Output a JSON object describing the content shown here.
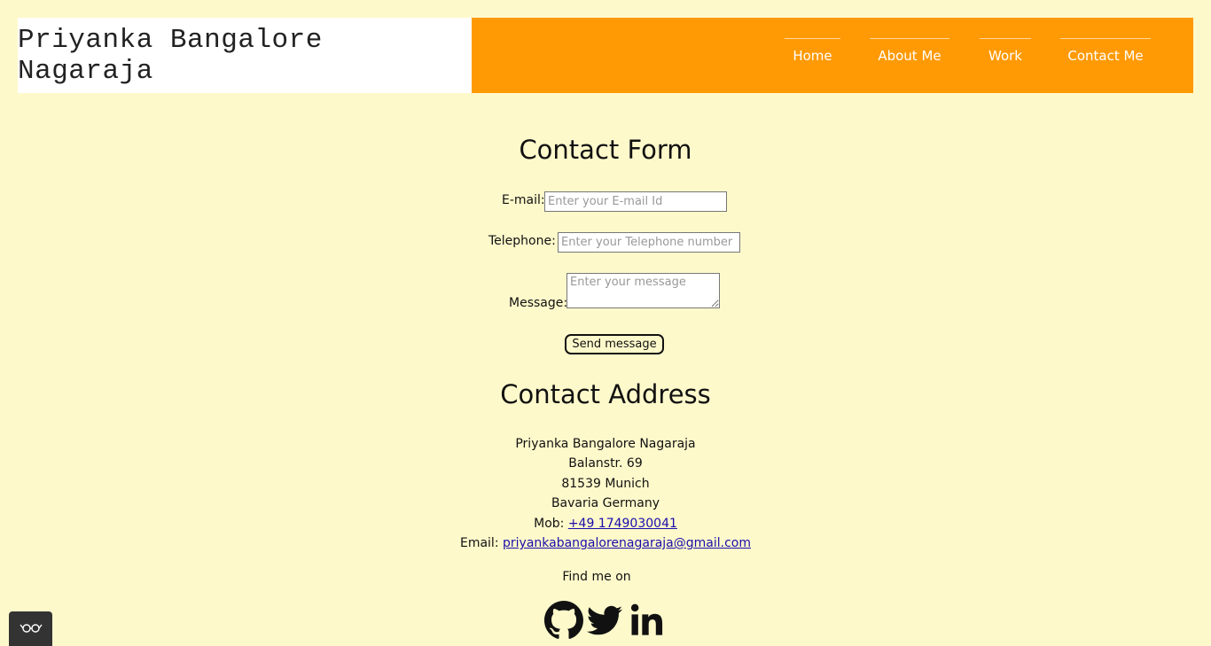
{
  "header": {
    "brand": "Priyanka Bangalore Nagaraja",
    "nav": [
      "Home",
      "About Me",
      "Work",
      "Contact Me"
    ]
  },
  "contact_form": {
    "title": "Contact Form",
    "email_label": "E-mail:",
    "email_placeholder": "Enter your E-mail Id",
    "telephone_label": "Telephone:",
    "telephone_placeholder": "Enter your Telephone number",
    "message_label": "Message:",
    "message_placeholder": "Enter your message",
    "send_label": "Send message"
  },
  "contact_address": {
    "title": "Contact Address",
    "name": "Priyanka Bangalore Nagaraja",
    "street": "Balanstr. 69",
    "city": "81539 Munich",
    "region": "Bavaria Germany",
    "mob_label": "Mob:",
    "mob": "+49 1749030041",
    "email_label": "Email:",
    "email": "priyankabangalorenagaraja@gmail.com",
    "find_me": "Find me on"
  },
  "socials": [
    "github-icon",
    "twitter-icon",
    "linkedin-icon"
  ],
  "colors": {
    "background": "#fef9cb",
    "nav": "#ff9a05",
    "link": "#1a0dab"
  }
}
